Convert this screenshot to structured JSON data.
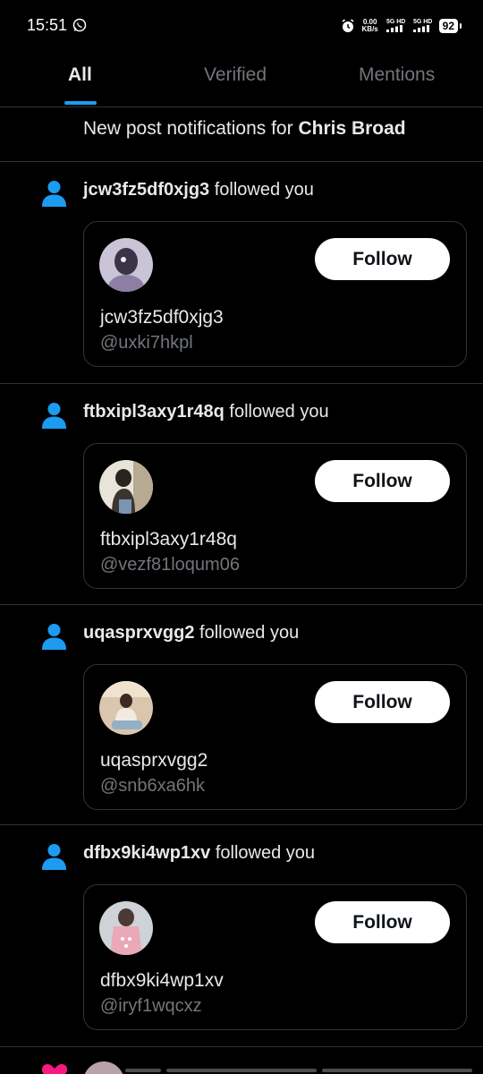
{
  "status_bar": {
    "time": "15:51",
    "net_speed_value": "0.00",
    "net_speed_unit": "KB/s",
    "net1": "5G HD",
    "net2": "5G HD",
    "battery": "92"
  },
  "tabs": [
    {
      "label": "All",
      "active": true
    },
    {
      "label": "Verified",
      "active": false
    },
    {
      "label": "Mentions",
      "active": false
    }
  ],
  "banner": {
    "prefix": "New post notifications for ",
    "name": "Chris Broad"
  },
  "notifications": [
    {
      "username": "jcw3fz5df0xjg3",
      "action": " followed you",
      "display_name": "jcw3fz5df0xjg3",
      "handle": "@uxki7hkpl",
      "button": "Follow"
    },
    {
      "username": "ftbxipl3axy1r48q",
      "action": " followed you",
      "display_name": "ftbxipl3axy1r48q",
      "handle": "@vezf81loqum06",
      "button": "Follow"
    },
    {
      "username": "uqasprxvgg2",
      "action": " followed you",
      "display_name": "uqasprxvgg2",
      "handle": "@snb6xa6hk",
      "button": "Follow"
    },
    {
      "username": "dfbx9ki4wp1xv",
      "action": " followed you",
      "display_name": "dfbx9ki4wp1xv",
      "handle": "@iryf1wqcxz",
      "button": "Follow"
    }
  ],
  "colors": {
    "accent": "#1d9bf0",
    "background": "#000000",
    "divider": "#2f3336",
    "secondary_text": "#71767b",
    "like": "#f91880"
  }
}
